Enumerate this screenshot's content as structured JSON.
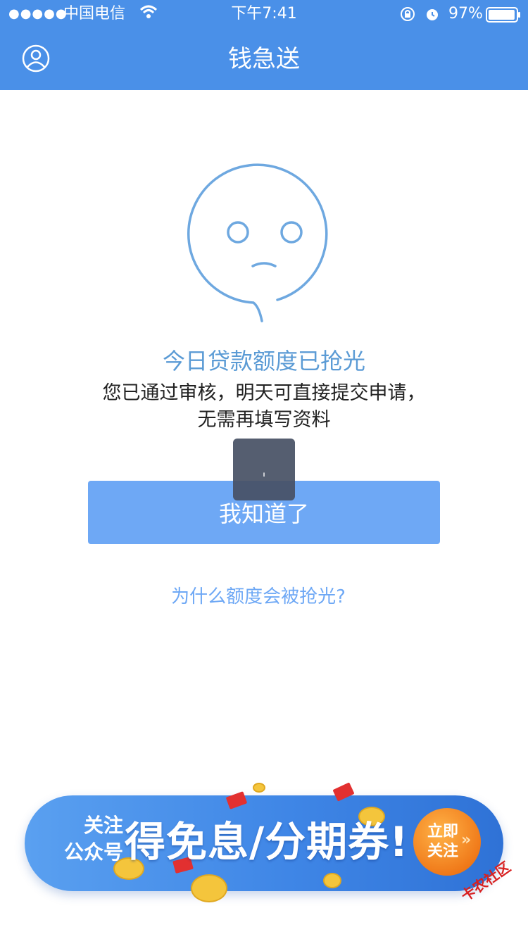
{
  "status_bar": {
    "signal": "●●●●●",
    "carrier": "中国电信",
    "time": "下午7:41",
    "battery": "97%",
    "battery_level": 0.97
  },
  "nav": {
    "title": "钱急送"
  },
  "result": {
    "headline": "今日贷款额度已抢光",
    "message_line1": "您已通过审核，明天可直接提交申请，",
    "message_line2": "无需再填写资料"
  },
  "loading": {
    "glyph": "ˌ"
  },
  "actions": {
    "ok_label": "我知道了",
    "why_link": "为什么额度会被抢光?"
  },
  "promo": {
    "follow_line1": "关注",
    "follow_line2": "公众号",
    "headline": "得免息/分期券!",
    "cta_line1": "立即",
    "cta_line2": "关注"
  },
  "watermark": "卡农社区",
  "colors": {
    "primary": "#4a90e8",
    "button": "#6ea8f5",
    "headline": "#5b9bd5",
    "cta": "#f07a1a"
  }
}
